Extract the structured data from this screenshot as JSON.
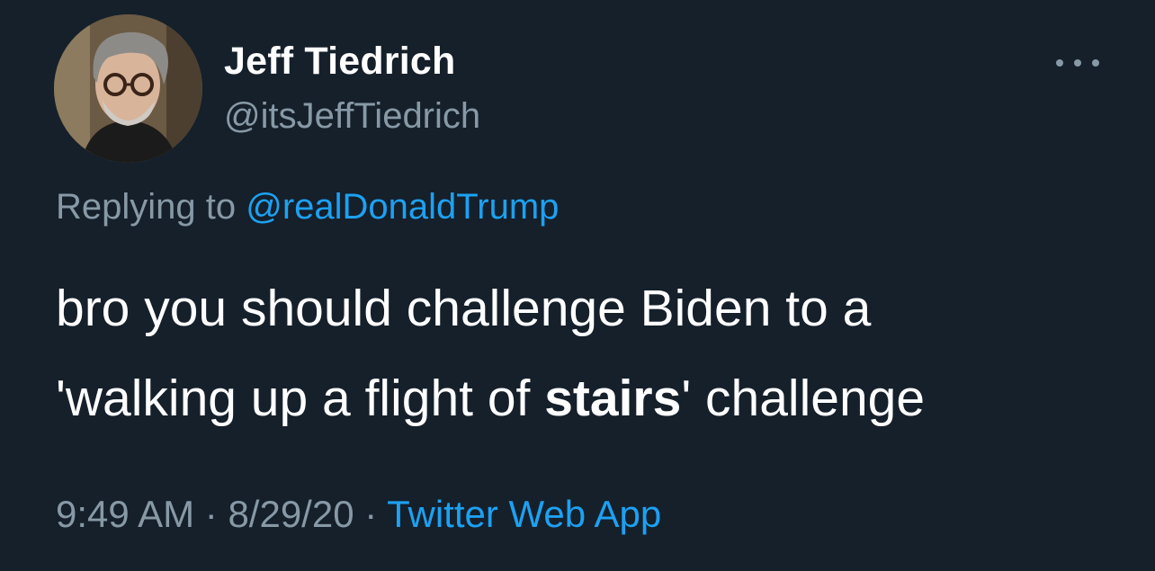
{
  "author": {
    "display_name": "Jeff Tiedrich",
    "handle": "@itsJeffTiedrich"
  },
  "more_icon": "more-horizontal-icon",
  "reply": {
    "prefix": "Replying to ",
    "mention": "@realDonaldTrump"
  },
  "tweet": {
    "line1": "bro you should challenge Biden to a",
    "line2_before": "'walking up a flight of ",
    "line2_bold": "stairs",
    "line2_after": "' challenge"
  },
  "meta": {
    "time": "9:49 AM",
    "sep1": " · ",
    "date": "8/29/20",
    "sep2": " · ",
    "source": "Twitter Web App"
  },
  "colors": {
    "background": "#15202b",
    "text": "#ffffff",
    "secondary": "#8899a6",
    "link": "#1da1f2"
  }
}
